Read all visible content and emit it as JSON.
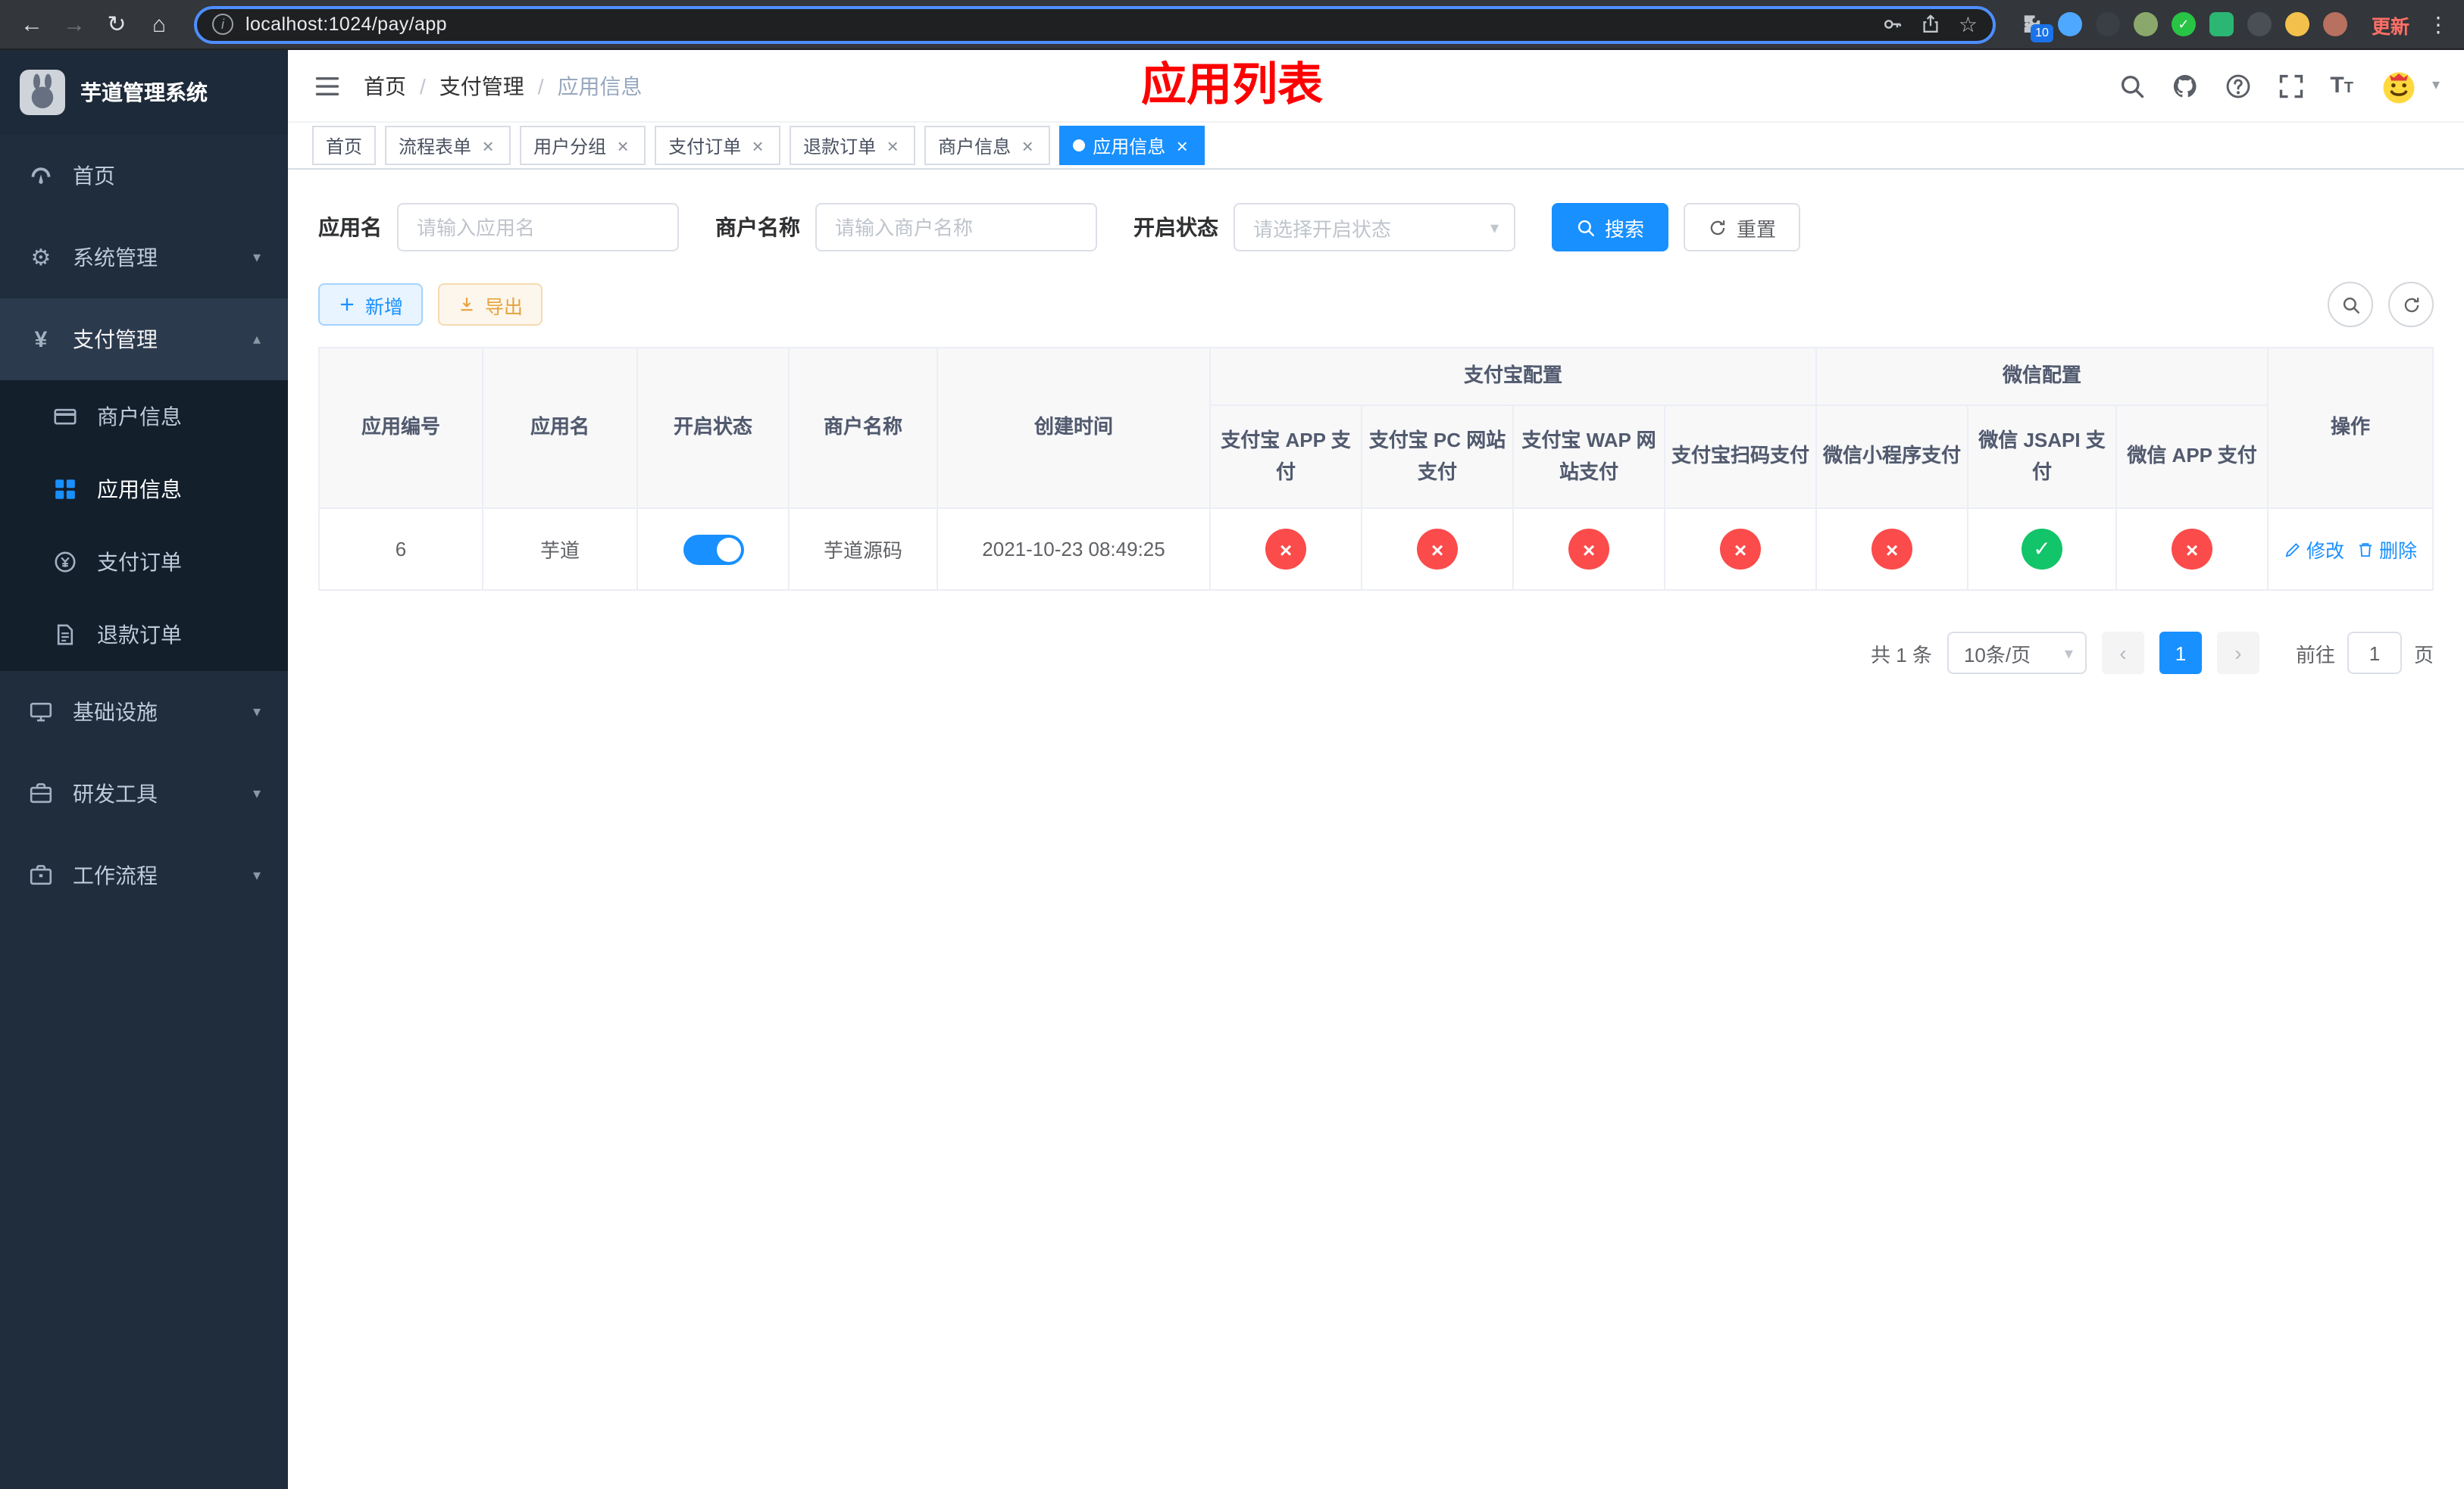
{
  "browser": {
    "url": "localhost:1024/pay/app",
    "extensions_badge": "10",
    "update_label": "更新"
  },
  "icons": {
    "back": "←",
    "forward": "→",
    "reload": "↻",
    "home": "⌂",
    "star": "☆",
    "gear": "⚙",
    "yen": "¥",
    "close": "×",
    "check": "✓",
    "cross": "×",
    "caret_down": "▾",
    "caret_up": "▴",
    "prev": "‹",
    "next": "›",
    "kebab": "⋮",
    "font_size_big": "T",
    "font_size_small": "T"
  },
  "sidebar": {
    "title": "芋道管理系统",
    "items": [
      {
        "label": "首页"
      },
      {
        "label": "系统管理"
      },
      {
        "label": "支付管理"
      },
      {
        "label": "基础设施"
      },
      {
        "label": "研发工具"
      },
      {
        "label": "工作流程"
      }
    ],
    "payment_children": [
      {
        "label": "商户信息"
      },
      {
        "label": "应用信息"
      },
      {
        "label": "支付订单"
      },
      {
        "label": "退款订单"
      }
    ]
  },
  "navbar": {
    "breadcrumb": [
      "首页",
      "支付管理",
      "应用信息"
    ],
    "page_title": "应用列表"
  },
  "tabs": [
    {
      "label": "首页"
    },
    {
      "label": "流程表单"
    },
    {
      "label": "用户分组"
    },
    {
      "label": "支付订单"
    },
    {
      "label": "退款订单"
    },
    {
      "label": "商户信息"
    },
    {
      "label": "应用信息"
    }
  ],
  "filters": {
    "app_name_label": "应用名",
    "app_name_placeholder": "请输入应用名",
    "merchant_label": "商户名称",
    "merchant_placeholder": "请输入商户名称",
    "status_label": "开启状态",
    "status_placeholder": "请选择开启状态",
    "search_label": "搜索",
    "reset_label": "重置"
  },
  "toolbar": {
    "add_label": "新增",
    "export_label": "导出"
  },
  "table": {
    "groups": {
      "alipay": "支付宝配置",
      "wechat": "微信配置"
    },
    "columns": {
      "id": "应用编号",
      "name": "应用名",
      "status": "开启状态",
      "merchant": "商户名称",
      "created": "创建时间",
      "alipay_app": "支付宝 APP 支付",
      "alipay_pc": "支付宝 PC 网站支付",
      "alipay_wap": "支付宝 WAP 网站支付",
      "alipay_qr": "支付宝扫码支付",
      "wx_mini": "微信小程序支付",
      "wx_jsapi": "微信 JSAPI 支付",
      "wx_app": "微信 APP 支付",
      "actions": "操作"
    },
    "row": {
      "id": "6",
      "name": "芋道",
      "status_on": true,
      "merchant": "芋道源码",
      "created": "2021-10-23 08:49:25",
      "configs": [
        false,
        false,
        false,
        false,
        false,
        true,
        false
      ],
      "edit_label": "修改",
      "delete_label": "删除"
    }
  },
  "pagination": {
    "total": "共 1 条",
    "page_size": "10条/页",
    "current": "1",
    "goto_label": "前往",
    "goto_value": "1",
    "page_unit": "页"
  },
  "colors": {
    "primary": "#1890ff",
    "success": "#12c46a",
    "danger": "#fb4b4b",
    "page_title_red": "#fe0000",
    "export_orange": "#e6a23c"
  }
}
